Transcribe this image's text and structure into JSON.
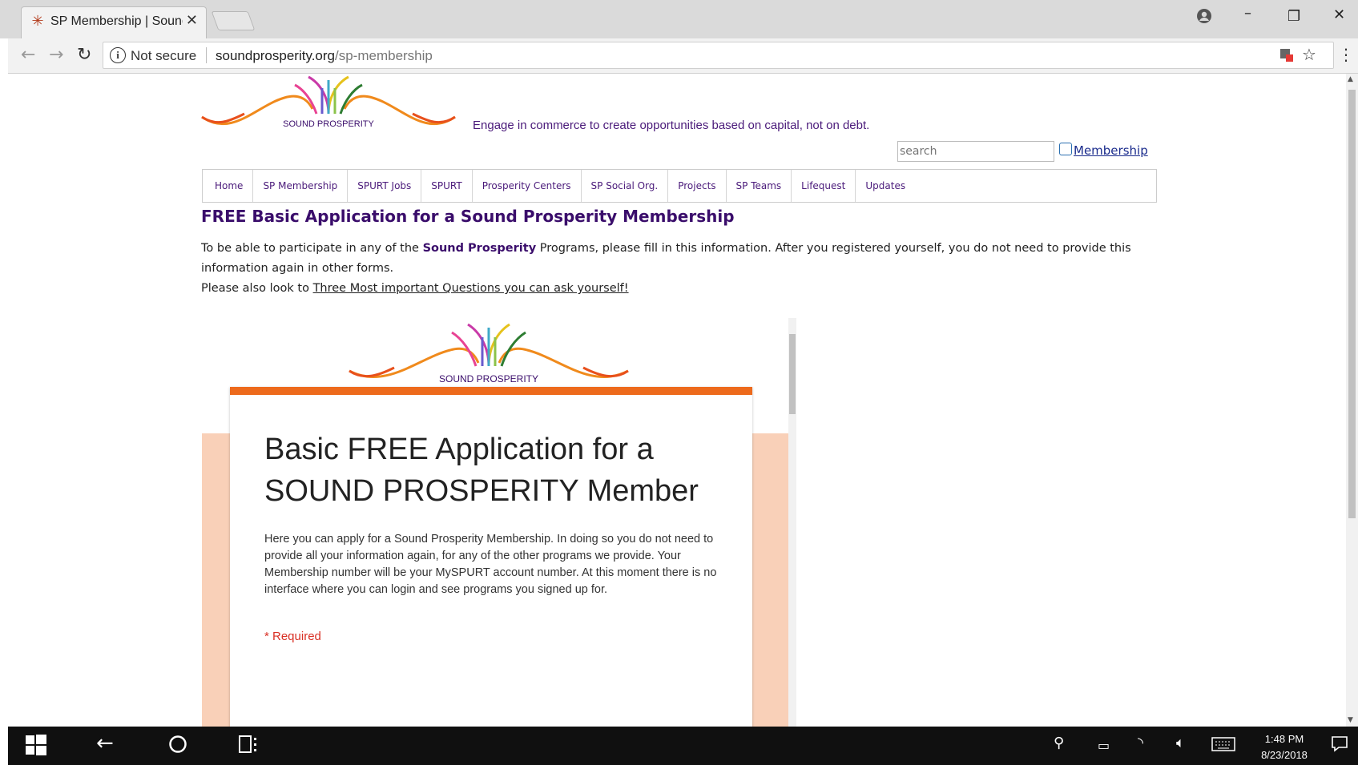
{
  "browser": {
    "tab_title": "SP Membership | Sound P",
    "tab_close": "✕",
    "address": {
      "security_label": "Not secure",
      "domain": "soundprosperity.org",
      "path": "/sp-membership"
    }
  },
  "site": {
    "logo_text": "SOUND PROSPERITY",
    "tagline": "Engage in commerce to create opportunities based on capital, not on debt.",
    "search_placeholder": "search",
    "membership_link": "Membership",
    "nav": [
      "Home",
      "SP Membership",
      "SPURT Jobs",
      "SPURT",
      "Prosperity Centers",
      "SP Social Org.",
      "Projects",
      "SP Teams",
      "Lifequest",
      "Updates"
    ]
  },
  "content": {
    "heading": "FREE Basic Application for a Sound Prosperity Membership",
    "intro_part1": "To be able to participate in any of the ",
    "intro_bold": "Sound Prosperity",
    "intro_part2": " Programs, please fill in this information. After you registered yourself, you do not need to provide this information again in other forms.",
    "intro_line2_prefix": "Please also look to ",
    "intro_link": "Three Most important Questions you can ask yourself!"
  },
  "form": {
    "logo_text": "SOUND PROSPERITY",
    "title": "Basic FREE Application for a SOUND PROSPERITY Member",
    "description": "Here you can apply for a  Sound Prosperity Membership. In doing so you do not need to provide all your information again, for any of the other programs we provide. Your Membership number will be your MySPURT account number. At this moment there is no interface where you can login and see programs you signed up for.",
    "required_note": "* Required"
  },
  "taskbar": {
    "time": "1:48 PM",
    "date": "8/23/2018"
  },
  "colors": {
    "accent_orange": "#ed6a1c",
    "band_peach": "#f9d0b8",
    "site_purple": "#3a0d6b",
    "required_red": "#d93025"
  }
}
